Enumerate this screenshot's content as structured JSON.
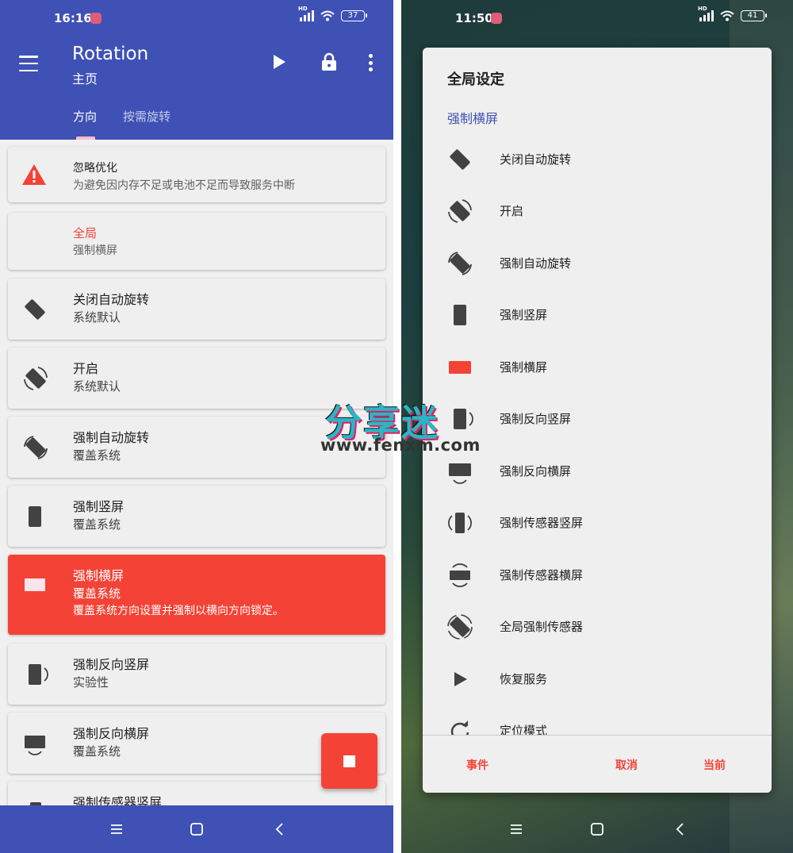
{
  "left": {
    "status": {
      "time": "16:16",
      "battery": "37"
    },
    "appbar": {
      "title": "Rotation",
      "subtitle": "主页",
      "tabs": [
        {
          "label": "方向",
          "selected": true
        },
        {
          "label": "按需旋转",
          "selected": false
        }
      ]
    },
    "cards": [
      {
        "title": "忽略优化",
        "sub": "为避免因内存不足或电池不足而导致服务中断"
      },
      {
        "title": "全局",
        "sub": "强制横屏"
      },
      {
        "title": "关闭自动旋转",
        "sub": "系统默认"
      },
      {
        "title": "开启",
        "sub": "系统默认"
      },
      {
        "title": "强制自动旋转",
        "sub": "覆盖系统"
      },
      {
        "title": "强制竖屏",
        "sub": "覆盖系统"
      },
      {
        "title": "强制横屏",
        "sub": "覆盖系统",
        "desc": "覆盖系统方向设置并强制以横向方向锁定。"
      },
      {
        "title": "强制反向竖屏",
        "sub": "实验性"
      },
      {
        "title": "强制反向横屏",
        "sub": "覆盖系统"
      },
      {
        "title": "强制传感器竖屏",
        "sub": ""
      }
    ],
    "colors": {
      "primary": "#3f51b5",
      "accent": "#f44336"
    }
  },
  "right": {
    "status": {
      "time": "11:50",
      "battery": "41"
    },
    "dialog": {
      "title": "全局设定",
      "selected": "强制横屏",
      "options": [
        {
          "label": "关闭自动旋转",
          "icon": "phone-tilted-icon"
        },
        {
          "label": "开启",
          "icon": "auto-rotate-icon"
        },
        {
          "label": "强制自动旋转",
          "icon": "forced-auto-rotate-icon"
        },
        {
          "label": "强制竖屏",
          "icon": "portrait-icon"
        },
        {
          "label": "强制横屏",
          "icon": "landscape-icon"
        },
        {
          "label": "强制反向竖屏",
          "icon": "reverse-portrait-icon"
        },
        {
          "label": "强制反向横屏",
          "icon": "reverse-landscape-icon"
        },
        {
          "label": "强制传感器竖屏",
          "icon": "sensor-portrait-icon"
        },
        {
          "label": "强制传感器横屏",
          "icon": "sensor-landscape-icon"
        },
        {
          "label": "全局强制传感器",
          "icon": "full-sensor-icon"
        },
        {
          "label": "恢复服务",
          "icon": "play-icon"
        },
        {
          "label": "定位模式",
          "icon": "refresh-icon"
        }
      ],
      "buttons": {
        "event": "事件",
        "cancel": "取消",
        "current": "当前"
      }
    }
  },
  "watermark": {
    "text": "分享迷",
    "url": "www.fenxm.com"
  }
}
